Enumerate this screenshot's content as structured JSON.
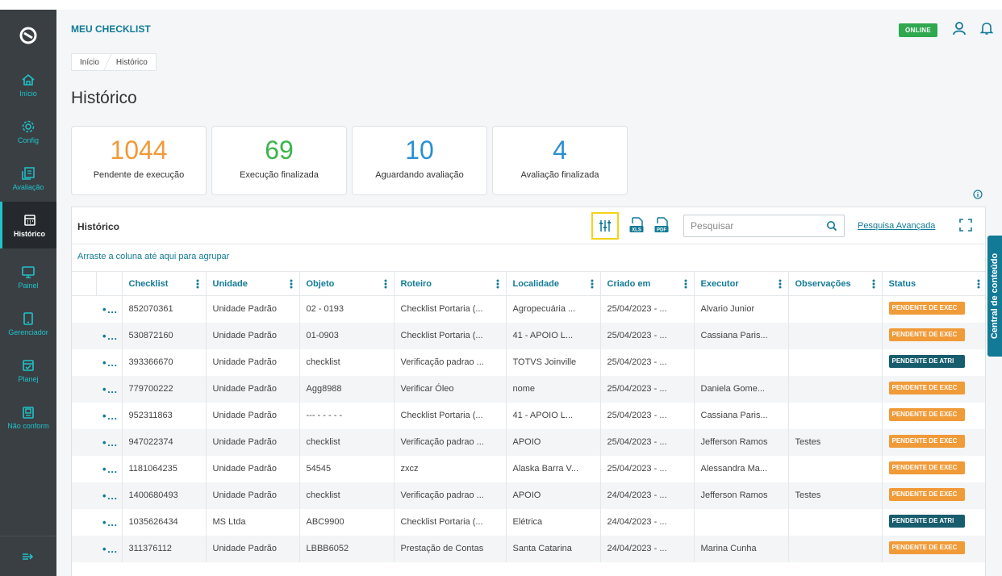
{
  "colors": {
    "sidebar": "#3a3f44",
    "teal": "#127a96",
    "accent": "#1ec4c9",
    "orange": "#f09a38",
    "green": "#3bb54a",
    "blue": "#2a8fd4",
    "dark_status": "#175d6e",
    "online": "#2fa84f",
    "highlight": "#f2d41b"
  },
  "sidebar": {
    "logo_icon": "logo-icon",
    "items": [
      {
        "label": "Início",
        "icon": "home-icon"
      },
      {
        "label": "Config",
        "icon": "gear-icon"
      },
      {
        "label": "Avaliação",
        "icon": "evaluation-icon"
      },
      {
        "label": "Histórico",
        "icon": "calendar-icon",
        "active": true
      },
      {
        "label": "Painel",
        "icon": "monitor-icon"
      },
      {
        "label": "Gerenciador",
        "icon": "tablet-icon"
      },
      {
        "label": "Planej",
        "icon": "calendar-check-icon"
      },
      {
        "label": "Não conform",
        "icon": "clipboard-icon"
      }
    ],
    "collapse_icon": "expand-arrow-icon"
  },
  "header": {
    "title": "MEU CHECKLIST",
    "status_badge": "ONLINE",
    "user_icon": "user-icon",
    "bell_icon": "bell-icon"
  },
  "breadcrumb": [
    "Início",
    "Histórico"
  ],
  "page_title": "Histórico",
  "summary_cards": [
    {
      "value": "1044",
      "label": "Pendente de execução",
      "color": "#f09a38"
    },
    {
      "value": "69",
      "label": "Execução finalizada",
      "color": "#3bb54a"
    },
    {
      "value": "10",
      "label": "Aguardando avaliação",
      "color": "#2a8fd4"
    },
    {
      "value": "4",
      "label": "Avaliação finalizada",
      "color": "#2a8fd4"
    }
  ],
  "panel": {
    "title": "Histórico",
    "search_placeholder": "Pesquisar",
    "advanced_search_link": "Pesquisa Avançada",
    "group_hint": "Arraste a coluna até aqui para agrupar"
  },
  "table": {
    "columns": [
      "Checklist",
      "Unidade",
      "Objeto",
      "Roteiro",
      "Localidade",
      "Criado em",
      "Executor",
      "Observações",
      "Status"
    ],
    "actions_label": "•••",
    "rows": [
      {
        "checklist": "852070361",
        "unidade": "Unidade Padrão",
        "objeto": "02 - 0193",
        "roteiro": "Checklist Portaria (...",
        "localidade": "Agropecuária ...",
        "criado": "25/04/2023 - ...",
        "executor": "Alvario Junior",
        "obs": "",
        "status": "PENDENTE DE EXEC",
        "status_color": "#f09a38"
      },
      {
        "checklist": "530872160",
        "unidade": "Unidade Padrão",
        "objeto": "01-0903",
        "roteiro": "Checklist Portaria (...",
        "localidade": "41 - APOIO L...",
        "criado": "25/04/2023 - ...",
        "executor": "Cassiana Paris...",
        "obs": "",
        "status": "PENDENTE DE EXEC",
        "status_color": "#f09a38"
      },
      {
        "checklist": "393366670",
        "unidade": "Unidade Padrão",
        "objeto": "checklist",
        "roteiro": "Verificação padrao ...",
        "localidade": "TOTVS Joinville",
        "criado": "25/04/2023 - ...",
        "executor": "",
        "obs": "",
        "status": "PENDENTE DE ATRI",
        "status_color": "#175d6e"
      },
      {
        "checklist": "779700222",
        "unidade": "Unidade Padrão",
        "objeto": "Agg8988",
        "roteiro": "Verificar Óleo",
        "localidade": "nome",
        "criado": "25/04/2023 - ...",
        "executor": "Daniela Gome...",
        "obs": "",
        "status": "PENDENTE DE EXEC",
        "status_color": "#f09a38"
      },
      {
        "checklist": "952311863",
        "unidade": "Unidade Padrão",
        "objeto": "--- - - - - -",
        "roteiro": "Checklist Portaria (...",
        "localidade": "41 - APOIO L...",
        "criado": "25/04/2023 - ...",
        "executor": "Cassiana Paris...",
        "obs": "",
        "status": "PENDENTE DE EXEC",
        "status_color": "#f09a38"
      },
      {
        "checklist": "947022374",
        "unidade": "Unidade Padrão",
        "objeto": "checklist",
        "roteiro": "Verificação padrao ...",
        "localidade": "APOIO",
        "criado": "25/04/2023 - ...",
        "executor": "Jefferson Ramos",
        "obs": "Testes",
        "status": "PENDENTE DE EXEC",
        "status_color": "#f09a38"
      },
      {
        "checklist": "1181064235",
        "unidade": "Unidade Padrão",
        "objeto": "54545",
        "roteiro": "zxcz",
        "localidade": "Alaska Barra V...",
        "criado": "25/04/2023 - ...",
        "executor": "Alessandra Ma...",
        "obs": "",
        "status": "PENDENTE DE EXEC",
        "status_color": "#f09a38"
      },
      {
        "checklist": "1400680493",
        "unidade": "Unidade Padrão",
        "objeto": "checklist",
        "roteiro": "Verificação padrao ...",
        "localidade": "APOIO",
        "criado": "24/04/2023 - ...",
        "executor": "Jefferson Ramos",
        "obs": "Testes",
        "status": "PENDENTE DE EXEC",
        "status_color": "#f09a38"
      },
      {
        "checklist": "1035626434",
        "unidade": "MS Ltda",
        "objeto": "ABC9900",
        "roteiro": "Checklist Portaria (...",
        "localidade": "Elétrica",
        "criado": "24/04/2023 - ...",
        "executor": "",
        "obs": "",
        "status": "PENDENTE DE ATRI",
        "status_color": "#175d6e"
      },
      {
        "checklist": "311376112",
        "unidade": "Unidade Padrão",
        "objeto": "LBBB6052",
        "roteiro": "Prestação de Contas",
        "localidade": "Santa Catarina",
        "criado": "24/04/2023 - ...",
        "executor": "Marina Cunha",
        "obs": "",
        "status": "PENDENTE DE EXEC",
        "status_color": "#f09a38"
      }
    ]
  },
  "side_tab": "Central de conteúdo"
}
